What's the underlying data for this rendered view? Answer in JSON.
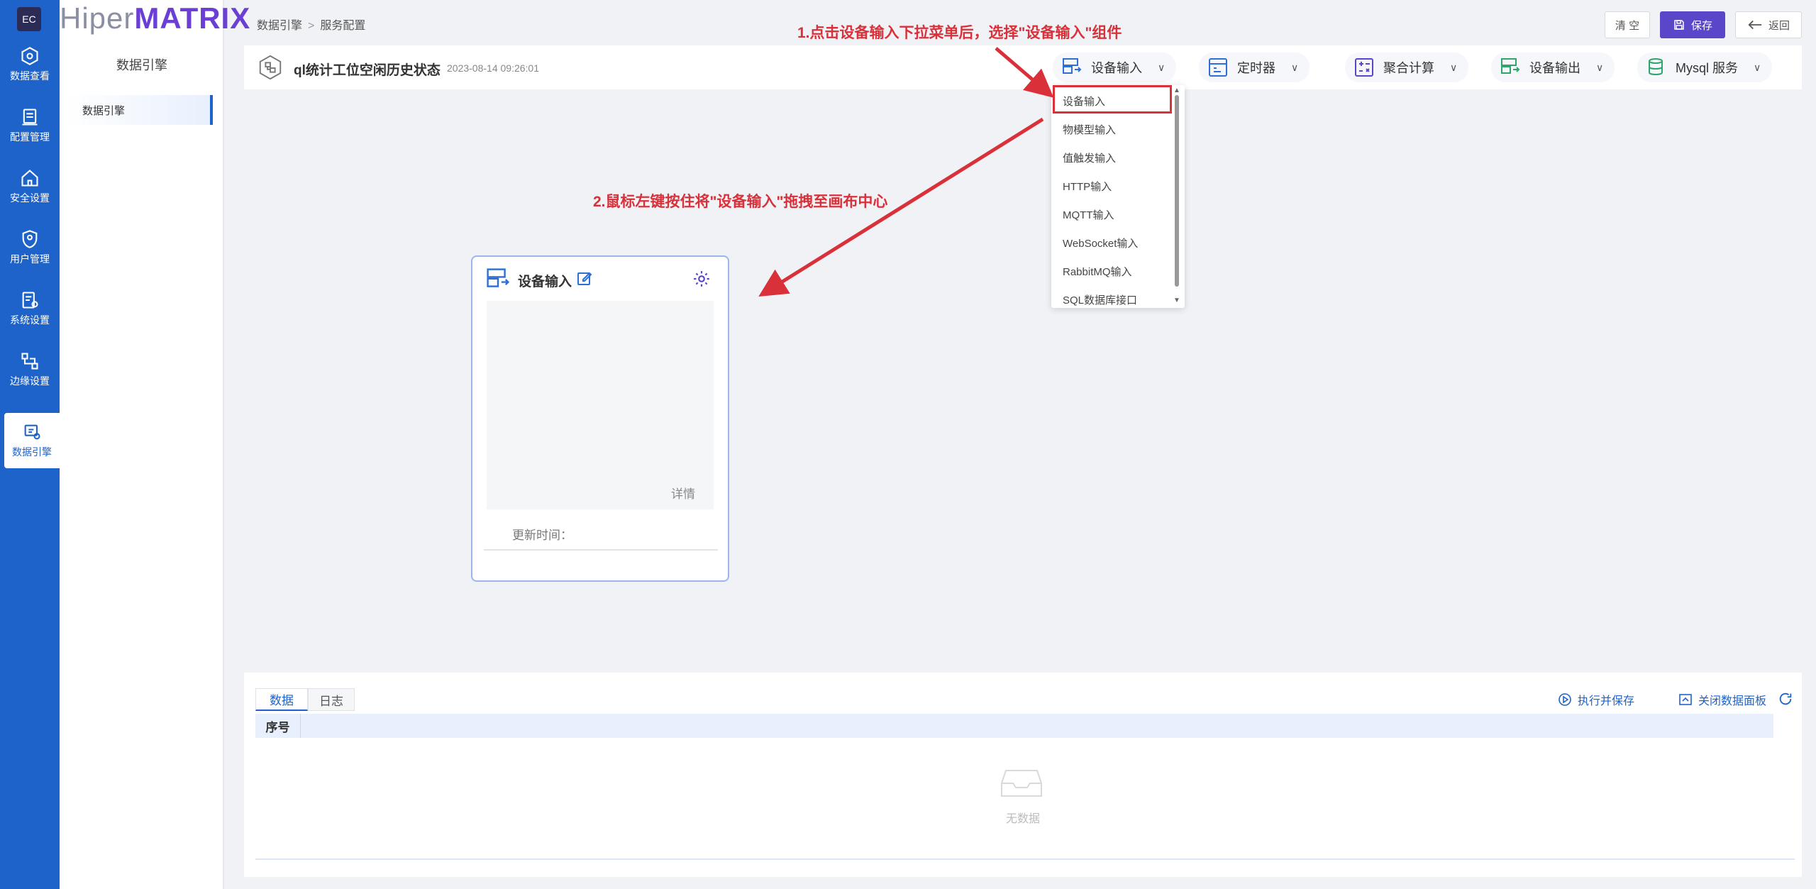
{
  "rail": {
    "logo": "EC",
    "items": [
      {
        "label": "数据查看",
        "icon": "cube-icon"
      },
      {
        "label": "配置管理",
        "icon": "document-icon"
      },
      {
        "label": "安全设置",
        "icon": "home-shield-icon"
      },
      {
        "label": "用户管理",
        "icon": "user-shield-icon"
      },
      {
        "label": "系统设置",
        "icon": "settings-doc-icon"
      },
      {
        "label": "边缘设置",
        "icon": "edge-icon"
      },
      {
        "label": "数据引擎",
        "icon": "engine-icon"
      }
    ]
  },
  "brand": {
    "part1": "Hiper",
    "part2": "MATRIX"
  },
  "sidebar": {
    "title": "数据引擎",
    "items": [
      {
        "label": "数据引擎"
      }
    ]
  },
  "breadcrumb": {
    "root": "数据引擎",
    "sep": ">",
    "current": "服务配置"
  },
  "actions": {
    "clear": "清 空",
    "save": "保存",
    "back": "返回"
  },
  "header": {
    "title": "ql统计工位空闲历史状态",
    "time": "2023-08-14 09:26:01",
    "tools": [
      {
        "label": "设备输入",
        "icon": "device-input-icon"
      },
      {
        "label": "定时器",
        "icon": "timer-icon"
      },
      {
        "label": "聚合计算",
        "icon": "calc-icon"
      },
      {
        "label": "设备输出",
        "icon": "device-output-icon"
      },
      {
        "label": "Mysql 服务",
        "icon": "database-icon"
      }
    ]
  },
  "dropdown": {
    "items": [
      "设备输入",
      "物模型输入",
      "值触发输入",
      "HTTP输入",
      "MQTT输入",
      "WebSocket输入",
      "RabbitMQ输入",
      "SQL数据库接口"
    ],
    "selected_index": 0
  },
  "annotations": {
    "step1": "1.点击设备输入下拉菜单后，选择\"设备输入\"组件",
    "step2": "2.鼠标左键按住将\"设备输入\"拖拽至画布中心"
  },
  "node": {
    "title": "设备输入",
    "detail": "详情",
    "updated": "更新时间："
  },
  "panel": {
    "tabs": [
      "数据",
      "日志"
    ],
    "active_tab": 0,
    "run_save": "执行并保存",
    "close_panel": "关闭数据面板",
    "column": "序号",
    "empty": "无数据"
  },
  "colors": {
    "primary": "#1e63c9",
    "accent": "#5a46c9",
    "annotation": "#d9303a"
  }
}
